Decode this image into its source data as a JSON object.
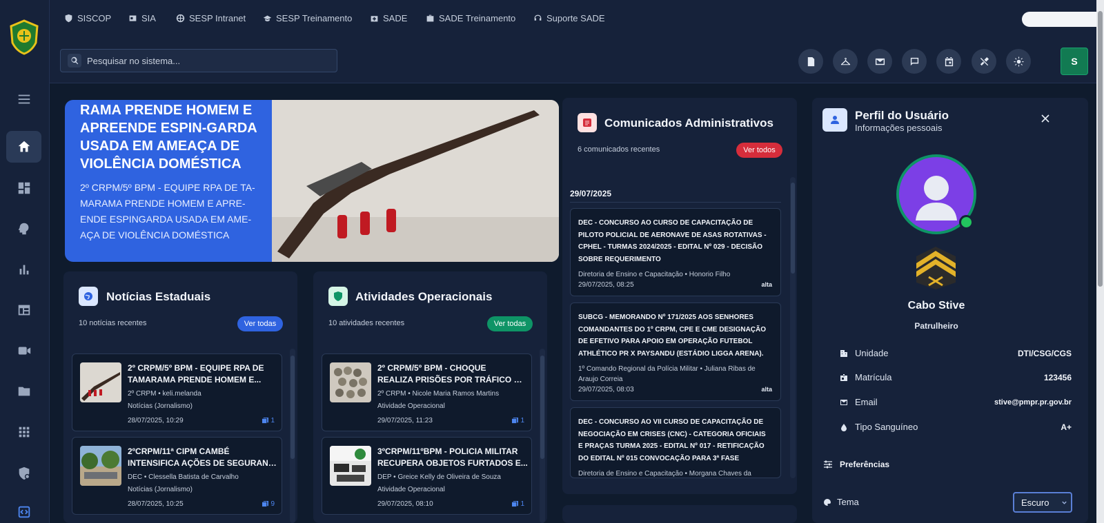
{
  "topnav": {
    "links": [
      {
        "label": "SISCOP",
        "icon": "shield-icon"
      },
      {
        "label": "SIA",
        "icon": "id-card-icon"
      },
      {
        "label": "SESP Intranet",
        "icon": "globe-icon"
      },
      {
        "label": "SESP Treinamento",
        "icon": "graduation-cap-icon"
      },
      {
        "label": "SADE",
        "icon": "medkit-icon"
      },
      {
        "label": "SADE Treinamento",
        "icon": "briefcase-icon"
      },
      {
        "label": "Suporte SADE",
        "icon": "headset-icon"
      }
    ]
  },
  "search": {
    "placeholder": "Pesquisar no sistema..."
  },
  "user": {
    "initial": "S"
  },
  "hero": {
    "title": "RAMA PRENDE HOMEM E APREENDE ESPIN-GARDA USADA EM AMEAÇA DE VIOLÊNCIA DOMÉSTICA",
    "subtitle": "2º CRPM/5º BPM - EQUIPE RPA DE TA-MARAMA PRENDE HOMEM E APRE-ENDE ESPINGARDA USADA EM AME-AÇA DE VIOLÊNCIA DOMÉSTICA"
  },
  "noticias": {
    "title": "Notícias Estaduais",
    "count": "10 notícias recentes",
    "button": "Ver todas",
    "items": [
      {
        "title1": "2º CRPM/5º BPM - EQUIPE RPA DE",
        "title2": "TAMARAMA PRENDE HOMEM E...",
        "meta1": "2º CRPM • keli.melanda",
        "meta2": "Notícias (Jornalismo)",
        "date": "28/07/2025, 10:29",
        "count": "1"
      },
      {
        "title1": "2ºCRPM/11ª CIPM  CAMBÉ",
        "title2": "INTENSIFICA AÇÕES DE SEGURANÇ...",
        "meta1": "DEC • Clessella Batista de Carvalho",
        "meta2": "Notícias (Jornalismo)",
        "date": "28/07/2025, 10:25",
        "count": "9"
      }
    ]
  },
  "atividades": {
    "title": "Atividades Operacionais",
    "count": "10 atividades recentes",
    "button": "Ver todas",
    "items": [
      {
        "title1": "2º CRPM/5º BPM - CHOQUE",
        "title2": "REALIZA PRISÕES POR TRÁFICO DE...",
        "meta1": "2º CRPM • Nicole Maria Ramos Martins",
        "meta2": "Atividade Operacional",
        "date": "29/07/2025, 11:23",
        "count": "1"
      },
      {
        "title1": "3ºCRPM/11ºBPM - POLICIA MILITAR",
        "title2": "RECUPERA OBJETOS FURTADOS E...",
        "meta1": "DEP • Greice Kelly de Oliveira de Souza",
        "meta2": "Atividade Operacional",
        "date": "29/07/2025, 08:10",
        "count": "1"
      }
    ]
  },
  "comunicados": {
    "title": "Comunicados Administrativos",
    "count": "6 comunicados recentes",
    "button": "Ver todos",
    "date_header": "29/07/2025",
    "items": [
      {
        "title": "DEC - CONCURSO AO CURSO DE CAPACITAÇÃO DE PILOTO POLICIAL DE AERONAVE DE ASAS ROTATIVAS - CPHel - TURMAS 2024/2025 - EDITAL Nº 029 - DECISÃO SOBRE REQUERIMENTO",
        "meta": "Diretoria de Ensino e Capacitação • Honorio Filho",
        "date": "29/07/2025, 08:25",
        "priority": "alta"
      },
      {
        "title": "SUBCG - MEMORANDO Nº 171/2025  AOS SENHORES COMANDANTES DO 1º CRPM, CPE E CME  DESIGNAÇÃO DE EFETIVO PARA APOIO EM OPERAÇÃO FUTEBOL  ATHLÉTICO  PR X PAYSANDU (ESTÁDIO LIGGA ARENA).",
        "meta": "1º Comando Regional da Polícia Militar • Juliana Ribas de Araujo Correia",
        "date": "29/07/2025, 08:03",
        "priority": "alta"
      },
      {
        "title": "DEC - CONCURSO AO VII CURSO DE CAPACITAÇÃO DE NEGOCIAÇÃO EM CRISES (CNC) - CATEGORIA OFICIAIS E PRAÇAS  TURMA 2025 - EDITAL Nº 017 - RETIFICAÇÃO DO EDITAL Nº 015  CONVOCAÇÃO PARA 3ª FASE",
        "meta": "Diretoria de Ensino e Capacitação • Morgana Chaves da",
        "date": "",
        "priority": ""
      }
    ]
  },
  "profile": {
    "title": "Perfil do Usuário",
    "subtitle": "Informações pessoais",
    "name": "Cabo Stive",
    "role": "Patrulheiro",
    "fields": [
      {
        "label": "Unidade",
        "value": "DTI/CSG/CGS"
      },
      {
        "label": "Matrícula",
        "value": "123456"
      },
      {
        "label": "Email",
        "value": "stive@pmpr.pr.gov.br"
      },
      {
        "label": "Tipo Sanguíneo",
        "value": "A+"
      }
    ],
    "prefs_title": "Preferências",
    "theme_label": "Tema",
    "theme_value": "Escuro"
  },
  "colors": {
    "accent_blue": "#2f63e0",
    "accent_green": "#0e9466",
    "accent_red": "#d62d3b",
    "online": "#22c55e"
  }
}
